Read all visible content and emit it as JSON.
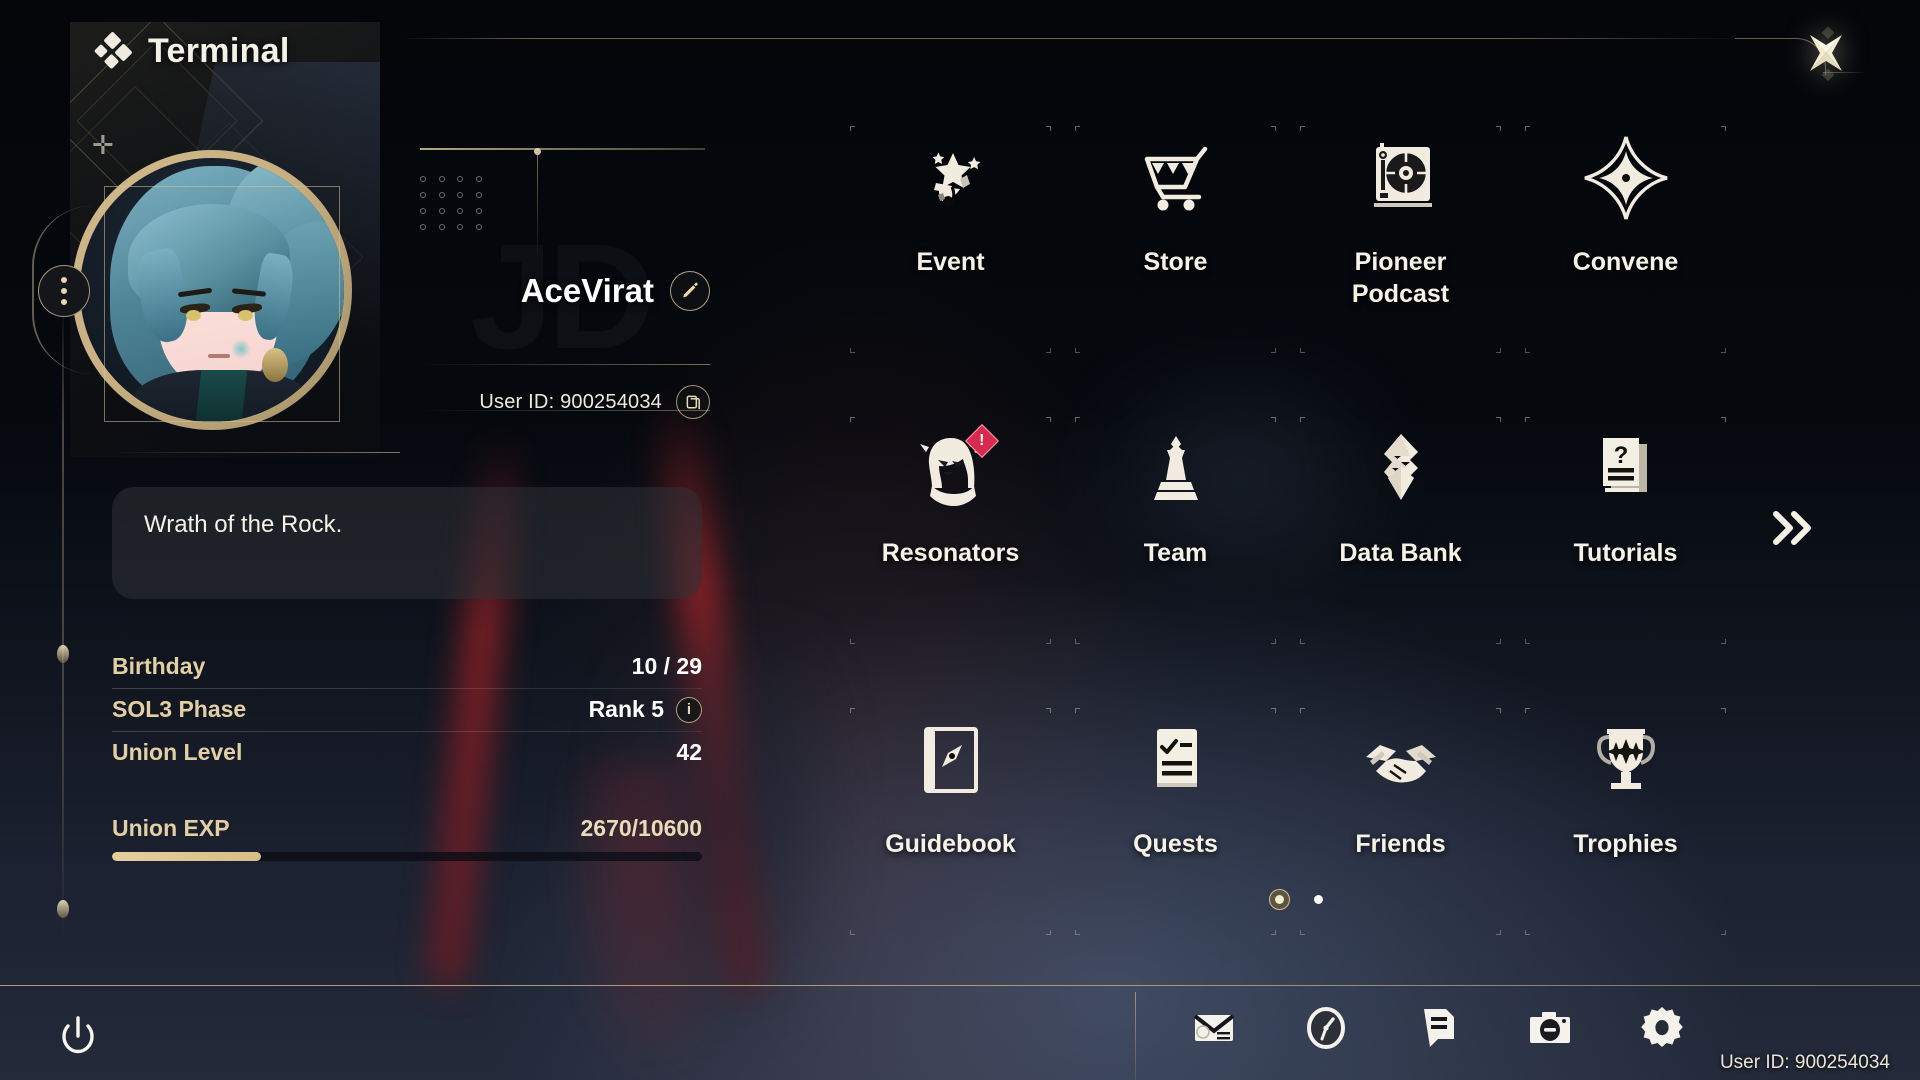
{
  "header": {
    "title": "Terminal",
    "diamond_icon": "diamond-cluster-icon",
    "close_icon": "close-star-icon"
  },
  "profile": {
    "player_name": "AceVirat",
    "edit_icon": "pencil-edit-icon",
    "user_id_label": "User ID: 900254034",
    "copy_icon": "copy-icon",
    "more_icon": "more-vertical-icon",
    "avatar_name": "avatar",
    "signature": "Wrath of the Rock.",
    "watermark": "JD",
    "stats": [
      {
        "label": "Birthday",
        "value": "10 / 29",
        "info": false
      },
      {
        "label": "SOL3 Phase",
        "value": "Rank 5",
        "info": true
      },
      {
        "label": "Union Level",
        "value": "42",
        "info": false
      }
    ],
    "exp": {
      "label": "Union EXP",
      "value": "2670/10600",
      "current": 2670,
      "max": 10600,
      "percent": 25.2
    }
  },
  "grid": {
    "items": [
      {
        "label": "Event",
        "icon": "sparkle-stars-icon",
        "badge": null
      },
      {
        "label": "Store",
        "icon": "shopping-cart-icon",
        "badge": null
      },
      {
        "label": "Pioneer\nPodcast",
        "icon": "turntable-icon",
        "badge": null
      },
      {
        "label": "Convene",
        "icon": "four-point-star-icon",
        "badge": null
      },
      {
        "label": "Resonators",
        "icon": "character-head-icon",
        "badge": "!"
      },
      {
        "label": "Team",
        "icon": "chess-pawn-icon",
        "badge": null
      },
      {
        "label": "Data Bank",
        "icon": "data-bank-icon",
        "badge": null
      },
      {
        "label": "Tutorials",
        "icon": "question-pages-icon",
        "badge": null
      },
      {
        "label": "Guidebook",
        "icon": "compass-book-icon",
        "badge": null
      },
      {
        "label": "Quests",
        "icon": "checklist-icon",
        "badge": null
      },
      {
        "label": "Friends",
        "icon": "handshake-icon",
        "badge": null
      },
      {
        "label": "Trophies",
        "icon": "trophy-icon",
        "badge": null
      }
    ],
    "next_page_icon": "chevron-double-right-icon",
    "pages": 2,
    "active_page": 1
  },
  "bottom_bar": {
    "power_icon": "power-icon",
    "system_icons": [
      "mail-icon",
      "compass-clock-icon",
      "notes-icon",
      "camera-icon",
      "settings-gear-icon"
    ],
    "user_id_label": "User ID: 900254034"
  },
  "colors": {
    "accent_gold": "#d6c496",
    "text_primary": "#f4f1e8",
    "label_gold": "#e2cfa3",
    "badge_red": "#d62a4e",
    "background": "#05070b"
  }
}
